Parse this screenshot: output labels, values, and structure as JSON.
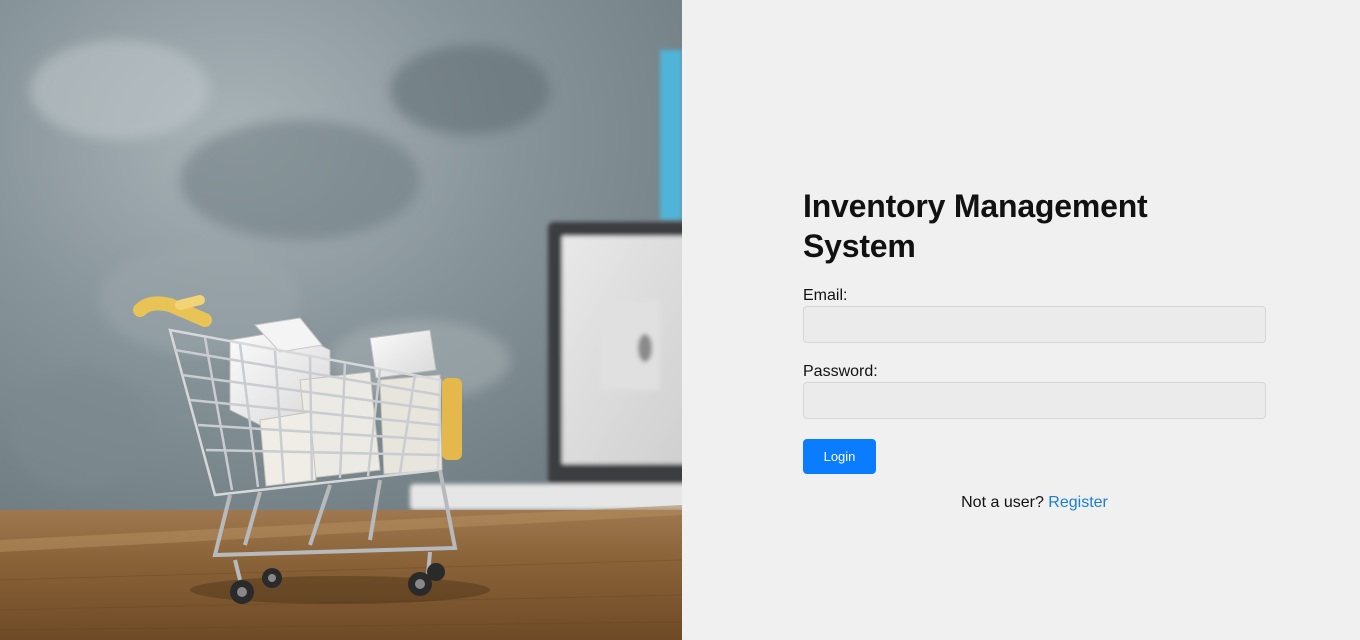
{
  "login": {
    "title": "Inventory Management System",
    "email_label": "Email:",
    "email_value": "",
    "password_label": "Password:",
    "password_value": "",
    "login_button": "Login",
    "register_prompt": "Not a user?",
    "register_link": "Register"
  },
  "colors": {
    "panel_background": "#f0f0f0",
    "primary_button": "#0a7cff",
    "link": "#1a7ed6",
    "input_background": "#ebebeb"
  },
  "hero": {
    "image_subject": "shopping-cart-with-boxes-on-desk-photo"
  }
}
